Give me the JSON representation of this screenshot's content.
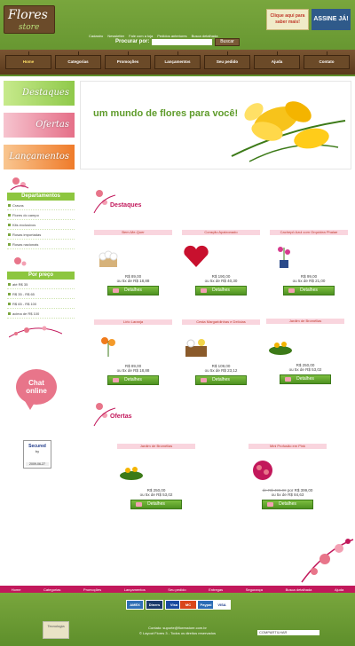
{
  "header": {
    "logo_line1": "Flores",
    "logo_line2": "store",
    "promo_text": "Clique aqui para saber mais!",
    "assine_label": "ASSINE JÁ!",
    "top_links": [
      "Cadastro",
      "Newsletter",
      "Fale com a loja",
      "Pedidos anteriores",
      "Busca detalhada"
    ],
    "search_label": "Procurar por:",
    "search_value": "",
    "search_button": "Buscar",
    "nav": [
      "Home",
      "Categorias",
      "Promoções",
      "Lançamentos",
      "Seu pedido",
      "Ajuda",
      "Contato"
    ]
  },
  "sidebar": {
    "banners": [
      "Destaques",
      "Ofertas",
      "Lançamentos"
    ],
    "departamentos_title": "Departamentos",
    "departamentos": [
      "Cravos",
      "Flores do campo",
      "Kits exclusivos",
      "Rosas importadas",
      "Rosas nacionais"
    ],
    "preco_title": "Por preço",
    "precos": [
      "até R$ 35",
      "R$ 35 - R$ 65",
      "R$ 65 - R$ 100",
      "acima de R$ 100"
    ],
    "chat_line1": "Chat",
    "chat_line2": "online",
    "secured_line1": "Secured",
    "secured_line2": "by",
    "secured_date": "2009-06-27"
  },
  "hero": {
    "text": "um mundo de flores para você!"
  },
  "destaques": {
    "title": "Destaques",
    "products": [
      {
        "name": "Bem-Me-Quer",
        "price": "R$ 89,00",
        "installments": "ou 5x de R$ 18,88",
        "button": "Detalhes"
      },
      {
        "name": "Coração Apaixonado",
        "price": "R$ 190,00",
        "installments": "ou 5x de R$ 40,30",
        "button": "Detalhes"
      },
      {
        "name": "Cachepô Azul com Orquídea Phalae",
        "price": "R$ 99,00",
        "installments": "ou 5x de R$ 21,00",
        "button": "Detalhes"
      },
      {
        "name": "Lírio Laranja",
        "price": "R$ 89,00",
        "installments": "ou 5x de R$ 18,88",
        "button": "Detalhes"
      },
      {
        "name": "Cesta Margaridinhas e Delícias",
        "price": "R$ 109,00",
        "installments": "ou 5x de R$ 23,12",
        "button": "Detalhes"
      },
      {
        "name": "Jardim de Bromélias",
        "price": "R$ 250,00",
        "installments": "ou 5x de R$ 53,02",
        "button": "Detalhes"
      }
    ]
  },
  "ofertas": {
    "title": "Ofertas",
    "products": [
      {
        "name": "Jardim de Bromélias",
        "price": "R$ 250,00",
        "installments": "ou 5x de R$ 53,02",
        "button": "Detalhes"
      },
      {
        "name": "Mini Profusão em Pink",
        "old_price": "de R$ 499,00",
        "price": "por R$ 399,00",
        "installments": "ou 5x de R$ 84,63",
        "button": "Detalhes"
      }
    ]
  },
  "footer": {
    "nav": [
      "Home",
      "Categorias",
      "Promoções",
      "Lançamentos",
      "Seu pedido",
      "Entregas",
      "Segurança",
      "Busca detalhada",
      "Ajuda"
    ],
    "payments": [
      "AMEX",
      "Diners",
      "Visa",
      "MC",
      "Paypal",
      "VISA"
    ],
    "contact": "Contato: suporte@floresstore.com.br",
    "copyright": "© Layout Flores 3 - Todos os direitos reservados",
    "seal": "Tecnologia",
    "share": "COMPARTILHAR"
  },
  "colors": {
    "green": "#79a63d",
    "brown": "#6b4a28",
    "pink": "#c2185b"
  }
}
